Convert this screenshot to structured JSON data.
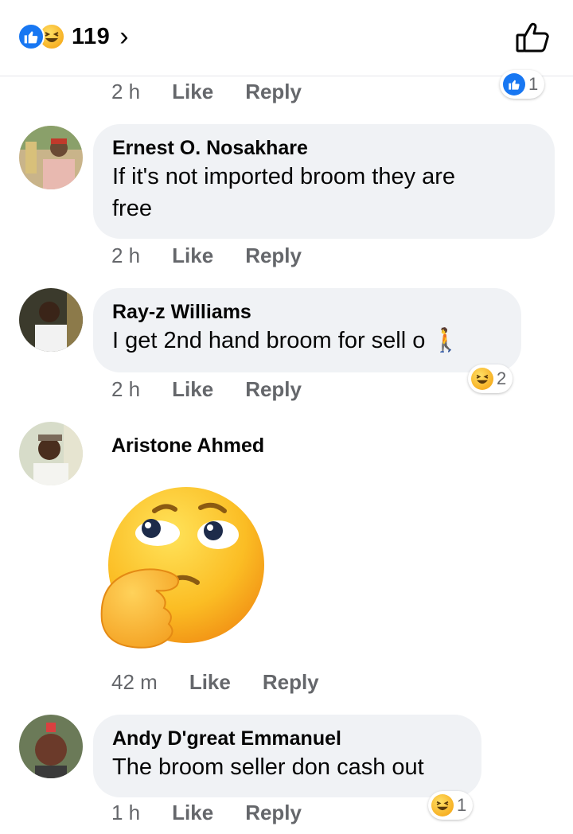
{
  "header": {
    "reaction_count": "119",
    "reaction_icons": [
      "like-icon",
      "haha-icon"
    ],
    "chevron": "›",
    "like_button_icon": "thumbs-up-outline-icon"
  },
  "comments": [
    {
      "time": "2 h",
      "like": "Like",
      "reply": "Reply",
      "reaction_count": "1",
      "reaction_icon": "like-icon"
    },
    {
      "author": "Ernest O. Nosakhare",
      "text_line1": "If it's not imported broom they are",
      "text_line2": "free",
      "time": "2 h",
      "like": "Like",
      "reply": "Reply"
    },
    {
      "author": "Ray-z Williams",
      "text": "I get 2nd hand broom for sell o",
      "emoji": "🚶",
      "time": "2 h",
      "like": "Like",
      "reply": "Reply",
      "reaction_count": "2",
      "reaction_icon": "haha-icon"
    },
    {
      "author": "Aristone Ahmed",
      "sticker": "thinking-face-sticker",
      "time": "42 m",
      "like": "Like",
      "reply": "Reply"
    },
    {
      "author": "Andy D'great Emmanuel",
      "text": "The broom seller don cash out",
      "time": "1 h",
      "like": "Like",
      "reply": "Reply",
      "reaction_count": "1",
      "reaction_icon": "haha-icon"
    }
  ],
  "colors": {
    "like_blue": "#1877f2",
    "bubble_bg": "#f0f2f5",
    "meta_gray": "#65676b",
    "haha_yellow": "#f7b125"
  }
}
